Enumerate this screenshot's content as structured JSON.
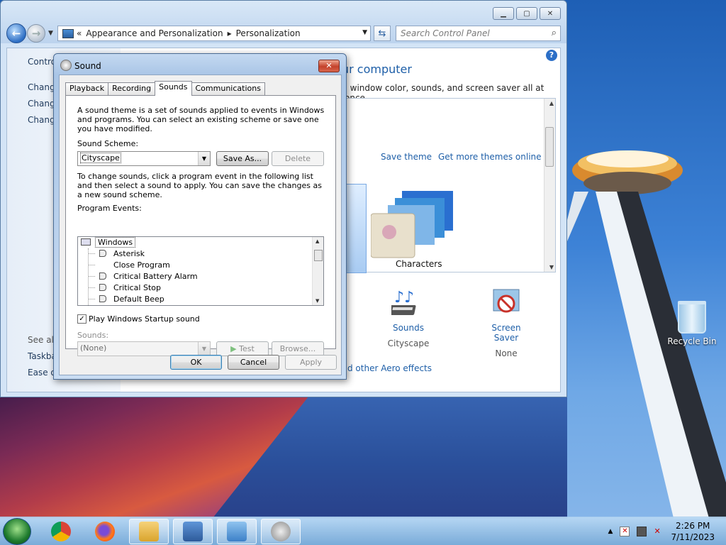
{
  "desktop": {
    "recycle_bin_label": "Recycle Bin"
  },
  "control_panel": {
    "address": {
      "overflow": "«",
      "segments": [
        "Appearance and Personalization",
        "Personalization"
      ]
    },
    "search_placeholder": "Search Control Panel",
    "sidebar": {
      "items": [
        "Control",
        "Change",
        "Change",
        "Change"
      ],
      "see_also": "See also",
      "see_also_items": [
        "Taskba",
        "Ease of"
      ]
    },
    "heading": "ur computer",
    "subheading": ", window color, sounds, and screen saver all at once.",
    "themes": {
      "save_theme": "Save theme",
      "get_more": "Get more themes online",
      "selected_theme_label": "Characters"
    },
    "bottom_items": [
      {
        "title": "Sounds",
        "value": "Cityscape"
      },
      {
        "title": "Screen Saver",
        "value": "None"
      }
    ],
    "aero_link": "d other Aero effects"
  },
  "sound_dialog": {
    "title": "Sound",
    "tabs": [
      "Playback",
      "Recording",
      "Sounds",
      "Communications"
    ],
    "active_tab": "Sounds",
    "intro": "A sound theme is a set of sounds applied to events in Windows and programs.  You can select an existing scheme or save one you have modified.",
    "scheme_label": "Sound Scheme:",
    "scheme_value": "Cityscape",
    "save_as_button": "Save As...",
    "delete_button": "Delete",
    "instructions": "To change sounds, click a program event in the following list and then select a sound to apply.  You can save the changes as a new sound scheme.",
    "events_label": "Program Events:",
    "events": {
      "group": "Windows",
      "items": [
        {
          "label": "Asterisk",
          "has_sound": true
        },
        {
          "label": "Close Program",
          "has_sound": false
        },
        {
          "label": "Critical Battery Alarm",
          "has_sound": true
        },
        {
          "label": "Critical Stop",
          "has_sound": true
        },
        {
          "label": "Default Beep",
          "has_sound": true
        }
      ]
    },
    "startup_checkbox": {
      "label": "Play Windows Startup sound",
      "checked": true
    },
    "sounds_label": "Sounds:",
    "sounds_value": "(None)",
    "test_button": "Test",
    "browse_button": "Browse...",
    "ok_button": "OK",
    "cancel_button": "Cancel",
    "apply_button": "Apply"
  },
  "taskbar": {
    "time": "2:26 PM",
    "date": "7/11/2023",
    "apps": [
      "chrome-icon",
      "firefox-icon",
      "file-explorer-icon",
      "remote-desktop-icon",
      "control-panel-icon",
      "sound-icon"
    ]
  }
}
